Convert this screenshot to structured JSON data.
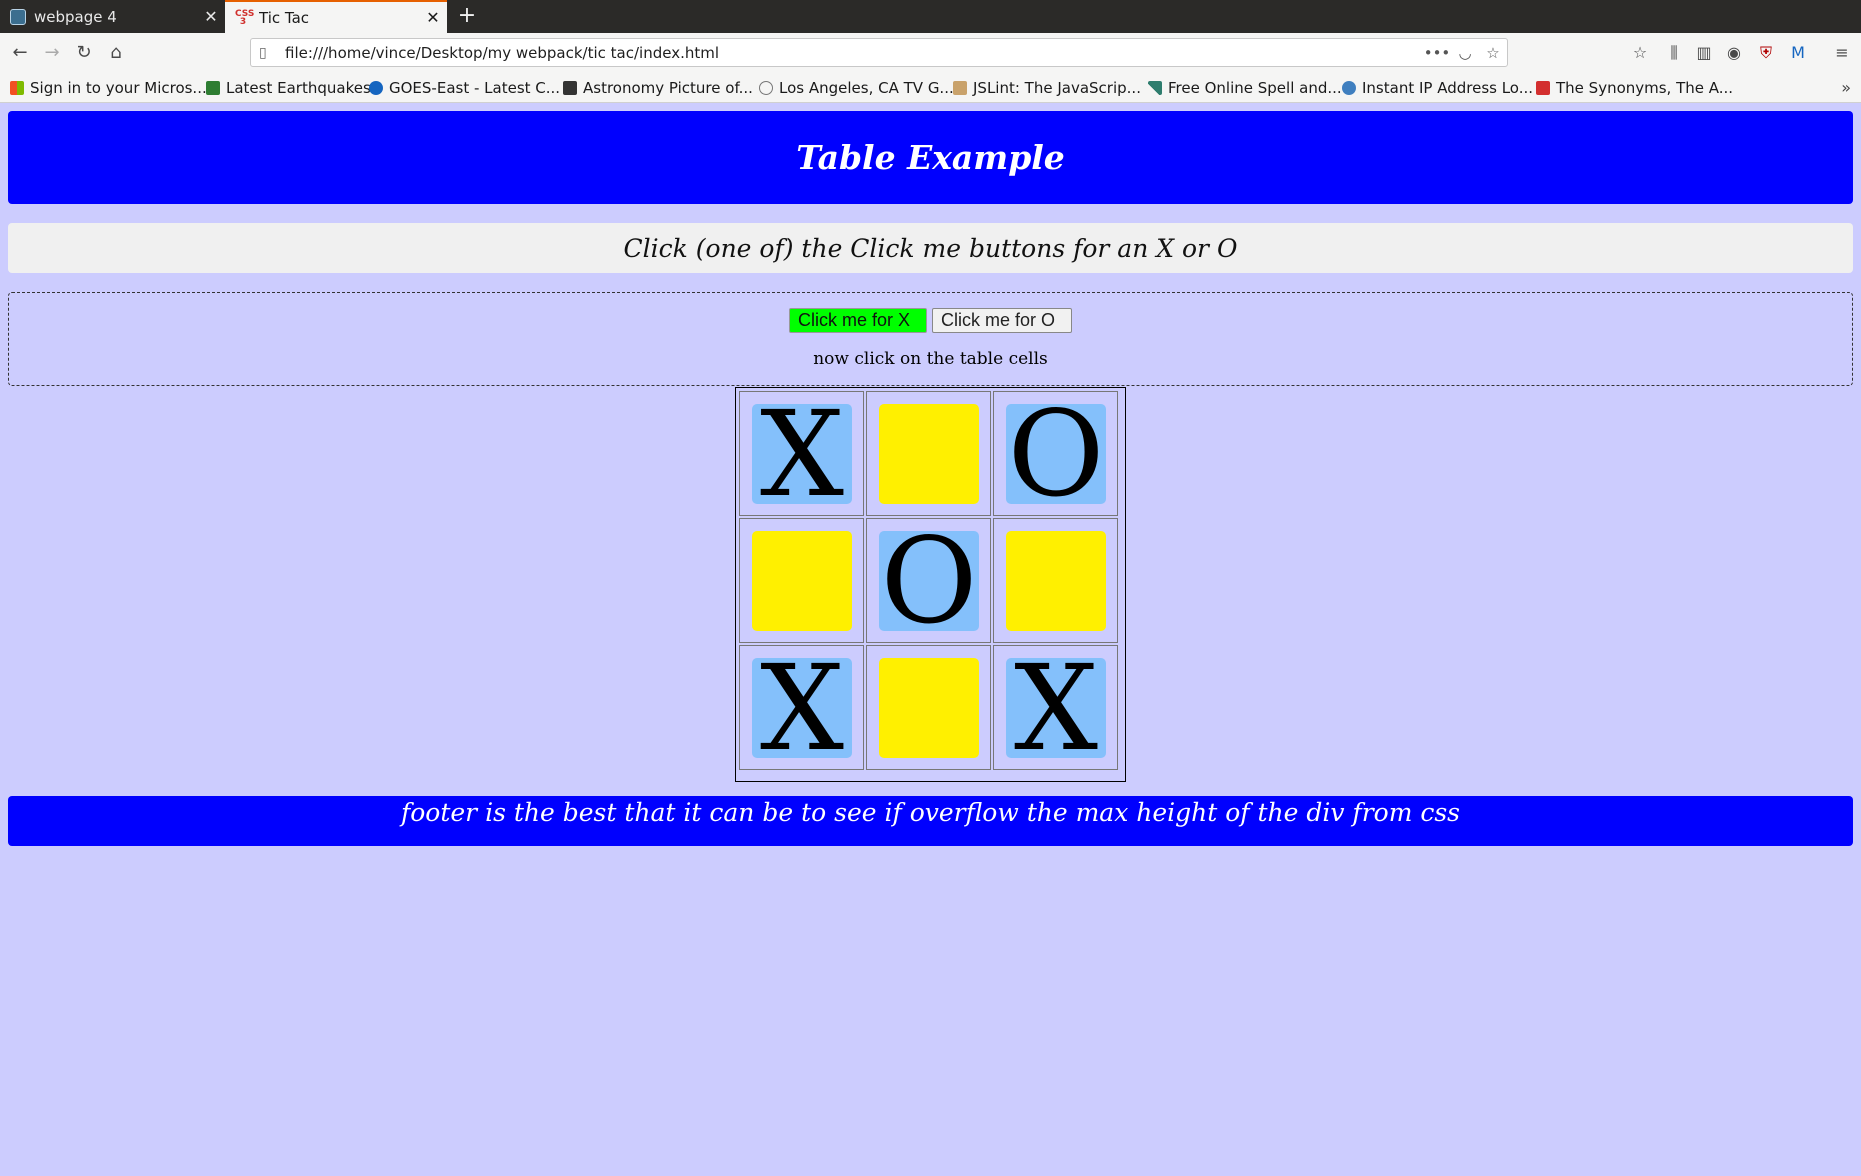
{
  "browser": {
    "tabs": [
      {
        "title": "webpage 4",
        "active": false
      },
      {
        "title": "Tic Tac",
        "active": true
      }
    ],
    "url": "file:///home/vince/Desktop/my webpack/tic tac/index.html",
    "bookmarks": [
      {
        "label": "Sign in to your Micros...",
        "icon_color": "#f25022"
      },
      {
        "label": "Latest Earthquakes",
        "icon_color": "#2e7d32"
      },
      {
        "label": "GOES-East - Latest C...",
        "icon_color": "#1565c0"
      },
      {
        "label": "Astronomy Picture of...",
        "icon_color": "#333333"
      },
      {
        "label": "Los Angeles, CA TV G...",
        "icon_color": "#777777"
      },
      {
        "label": "JSLint: The JavaScrip...",
        "icon_color": "#c9a26b"
      },
      {
        "label": "Free Online Spell and...",
        "icon_color": "#2e7d6e"
      },
      {
        "label": "Instant IP Address Lo...",
        "icon_color": "#3f7fbf"
      },
      {
        "label": "The Synonyms, The A...",
        "icon_color": "#d32f2f"
      }
    ]
  },
  "page": {
    "title": "Table Example",
    "instructions": "Click (one of) the Click me buttons for an X or O",
    "buttons": {
      "x_label": "Click me for X",
      "o_label": "Click me for O"
    },
    "hint": "now click on the table cells",
    "board": [
      [
        "X",
        "",
        "O"
      ],
      [
        "",
        "O",
        ""
      ],
      [
        "X",
        "",
        "X"
      ]
    ],
    "footer": "footer is the best that it can be to see if overflow the max height of the div from css"
  },
  "colors": {
    "page_bg": "#ccccfe",
    "header_bg": "#0000fe",
    "x_button_bg": "#00ff00",
    "filled_cell": "#84c0fb",
    "empty_cell": "#fff000"
  }
}
